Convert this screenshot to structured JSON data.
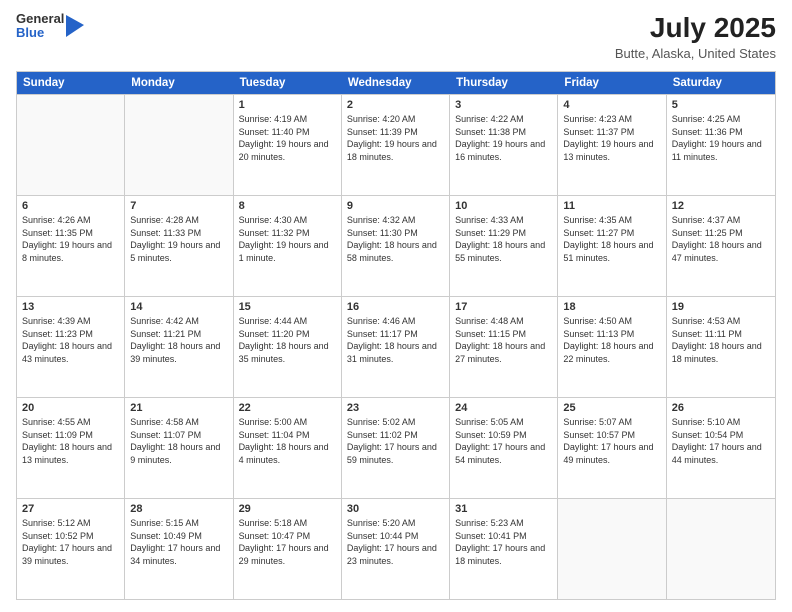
{
  "header": {
    "logo": {
      "general": "General",
      "blue": "Blue"
    },
    "title": "July 2025",
    "subtitle": "Butte, Alaska, United States"
  },
  "calendar": {
    "days": [
      "Sunday",
      "Monday",
      "Tuesday",
      "Wednesday",
      "Thursday",
      "Friday",
      "Saturday"
    ],
    "weeks": [
      [
        {
          "day": "",
          "info": ""
        },
        {
          "day": "",
          "info": ""
        },
        {
          "day": "1",
          "info": "Sunrise: 4:19 AM\nSunset: 11:40 PM\nDaylight: 19 hours and 20 minutes."
        },
        {
          "day": "2",
          "info": "Sunrise: 4:20 AM\nSunset: 11:39 PM\nDaylight: 19 hours and 18 minutes."
        },
        {
          "day": "3",
          "info": "Sunrise: 4:22 AM\nSunset: 11:38 PM\nDaylight: 19 hours and 16 minutes."
        },
        {
          "day": "4",
          "info": "Sunrise: 4:23 AM\nSunset: 11:37 PM\nDaylight: 19 hours and 13 minutes."
        },
        {
          "day": "5",
          "info": "Sunrise: 4:25 AM\nSunset: 11:36 PM\nDaylight: 19 hours and 11 minutes."
        }
      ],
      [
        {
          "day": "6",
          "info": "Sunrise: 4:26 AM\nSunset: 11:35 PM\nDaylight: 19 hours and 8 minutes."
        },
        {
          "day": "7",
          "info": "Sunrise: 4:28 AM\nSunset: 11:33 PM\nDaylight: 19 hours and 5 minutes."
        },
        {
          "day": "8",
          "info": "Sunrise: 4:30 AM\nSunset: 11:32 PM\nDaylight: 19 hours and 1 minute."
        },
        {
          "day": "9",
          "info": "Sunrise: 4:32 AM\nSunset: 11:30 PM\nDaylight: 18 hours and 58 minutes."
        },
        {
          "day": "10",
          "info": "Sunrise: 4:33 AM\nSunset: 11:29 PM\nDaylight: 18 hours and 55 minutes."
        },
        {
          "day": "11",
          "info": "Sunrise: 4:35 AM\nSunset: 11:27 PM\nDaylight: 18 hours and 51 minutes."
        },
        {
          "day": "12",
          "info": "Sunrise: 4:37 AM\nSunset: 11:25 PM\nDaylight: 18 hours and 47 minutes."
        }
      ],
      [
        {
          "day": "13",
          "info": "Sunrise: 4:39 AM\nSunset: 11:23 PM\nDaylight: 18 hours and 43 minutes."
        },
        {
          "day": "14",
          "info": "Sunrise: 4:42 AM\nSunset: 11:21 PM\nDaylight: 18 hours and 39 minutes."
        },
        {
          "day": "15",
          "info": "Sunrise: 4:44 AM\nSunset: 11:20 PM\nDaylight: 18 hours and 35 minutes."
        },
        {
          "day": "16",
          "info": "Sunrise: 4:46 AM\nSunset: 11:17 PM\nDaylight: 18 hours and 31 minutes."
        },
        {
          "day": "17",
          "info": "Sunrise: 4:48 AM\nSunset: 11:15 PM\nDaylight: 18 hours and 27 minutes."
        },
        {
          "day": "18",
          "info": "Sunrise: 4:50 AM\nSunset: 11:13 PM\nDaylight: 18 hours and 22 minutes."
        },
        {
          "day": "19",
          "info": "Sunrise: 4:53 AM\nSunset: 11:11 PM\nDaylight: 18 hours and 18 minutes."
        }
      ],
      [
        {
          "day": "20",
          "info": "Sunrise: 4:55 AM\nSunset: 11:09 PM\nDaylight: 18 hours and 13 minutes."
        },
        {
          "day": "21",
          "info": "Sunrise: 4:58 AM\nSunset: 11:07 PM\nDaylight: 18 hours and 9 minutes."
        },
        {
          "day": "22",
          "info": "Sunrise: 5:00 AM\nSunset: 11:04 PM\nDaylight: 18 hours and 4 minutes."
        },
        {
          "day": "23",
          "info": "Sunrise: 5:02 AM\nSunset: 11:02 PM\nDaylight: 17 hours and 59 minutes."
        },
        {
          "day": "24",
          "info": "Sunrise: 5:05 AM\nSunset: 10:59 PM\nDaylight: 17 hours and 54 minutes."
        },
        {
          "day": "25",
          "info": "Sunrise: 5:07 AM\nSunset: 10:57 PM\nDaylight: 17 hours and 49 minutes."
        },
        {
          "day": "26",
          "info": "Sunrise: 5:10 AM\nSunset: 10:54 PM\nDaylight: 17 hours and 44 minutes."
        }
      ],
      [
        {
          "day": "27",
          "info": "Sunrise: 5:12 AM\nSunset: 10:52 PM\nDaylight: 17 hours and 39 minutes."
        },
        {
          "day": "28",
          "info": "Sunrise: 5:15 AM\nSunset: 10:49 PM\nDaylight: 17 hours and 34 minutes."
        },
        {
          "day": "29",
          "info": "Sunrise: 5:18 AM\nSunset: 10:47 PM\nDaylight: 17 hours and 29 minutes."
        },
        {
          "day": "30",
          "info": "Sunrise: 5:20 AM\nSunset: 10:44 PM\nDaylight: 17 hours and 23 minutes."
        },
        {
          "day": "31",
          "info": "Sunrise: 5:23 AM\nSunset: 10:41 PM\nDaylight: 17 hours and 18 minutes."
        },
        {
          "day": "",
          "info": ""
        },
        {
          "day": "",
          "info": ""
        }
      ]
    ]
  }
}
